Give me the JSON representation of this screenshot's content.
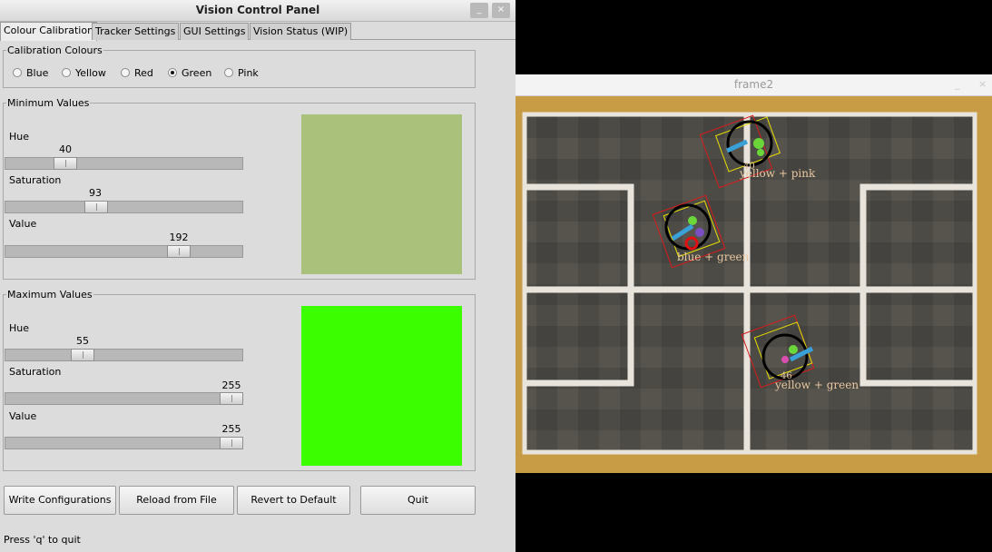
{
  "panel": {
    "title": "Vision Control Panel",
    "minimize_icon": "_",
    "close_icon": "×",
    "tabs": [
      "Colour Calibration",
      "Tracker Settings",
      "GUI Settings",
      "Vision Status (WIP)"
    ],
    "active_tab": "Colour Calibration",
    "calibration_group_title": "Calibration Colours",
    "colour_options": [
      "Blue",
      "Yellow",
      "Red",
      "Green",
      "Pink"
    ],
    "selected_colour": "Green",
    "min_group_title": "Minimum Values",
    "max_group_title": "Maximum Values",
    "slider_labels": {
      "hue": "Hue",
      "saturation": "Saturation",
      "value": "Value"
    },
    "min_values": {
      "hue": "40",
      "saturation": "93",
      "value": "192"
    },
    "max_values": {
      "hue": "55",
      "saturation": "255",
      "value": "255"
    },
    "min_swatch_color": "#a9c17b",
    "max_swatch_color": "#3bff00",
    "buttons": {
      "write": "Write Configurations",
      "reload": "Reload from File",
      "revert": "Revert to Default",
      "quit": "Quit"
    },
    "status": "Press 'q' to quit"
  },
  "frame": {
    "title": "frame2",
    "minimize_icon": "_",
    "close_icon": "×",
    "robot_labels": [
      "yellow + pink",
      "blue + green",
      "yellow + green"
    ],
    "robot_numbers": [
      "40",
      "46"
    ]
  }
}
